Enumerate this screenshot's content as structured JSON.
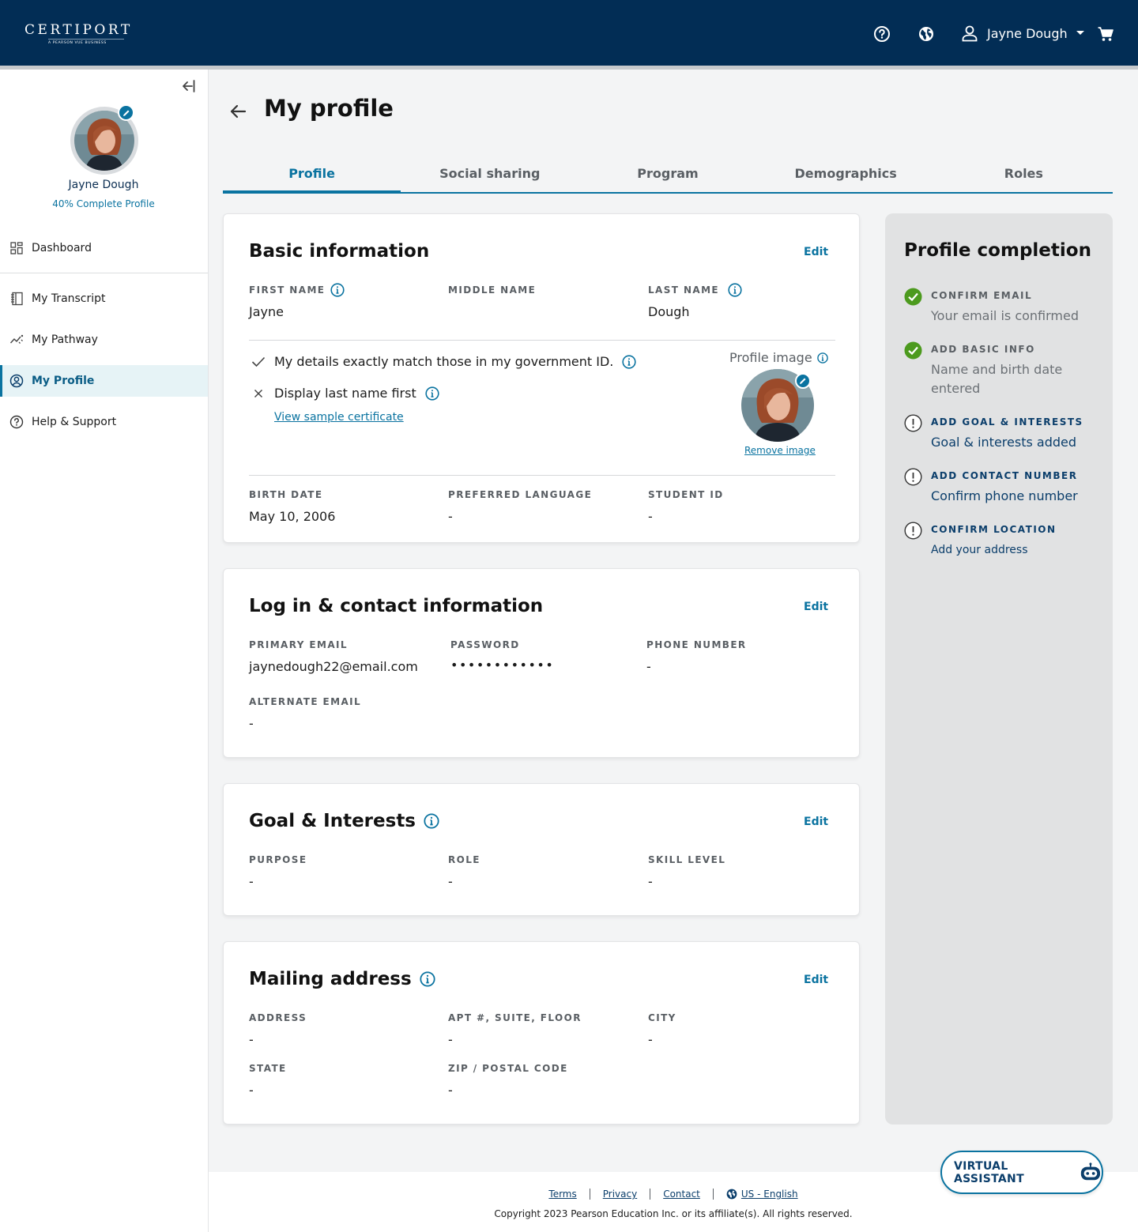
{
  "header": {
    "logo_text": "CERTIPORT",
    "logo_subtext": "A PEARSON VUE BUSINESS",
    "user_name": "Jayne Dough",
    "icons": [
      "help-icon",
      "globe-icon",
      "user-icon",
      "caret-down-icon",
      "cart-icon"
    ]
  },
  "sidebar": {
    "user_name": "Jayne Dough",
    "completion_text": "40% Complete Profile",
    "items": [
      {
        "label": "Dashboard",
        "icon": "dashboard-icon"
      },
      {
        "label": "My Transcript",
        "icon": "transcript-icon"
      },
      {
        "label": "My Pathway",
        "icon": "pathway-icon"
      },
      {
        "label": "My Profile",
        "icon": "profile-icon",
        "active": true
      },
      {
        "label": "Help & Support",
        "icon": "help-icon"
      }
    ]
  },
  "page": {
    "title": "My profile",
    "tabs": [
      {
        "label": "Profile",
        "active": true
      },
      {
        "label": "Social sharing"
      },
      {
        "label": "Program"
      },
      {
        "label": "Demographics"
      },
      {
        "label": "Roles"
      }
    ]
  },
  "basic_info": {
    "title": "Basic information",
    "edit": "Edit",
    "first_name_label": "FIRST NAME",
    "first_name": "Jayne",
    "middle_name_label": "MIDDLE NAME",
    "middle_name": "",
    "last_name_label": "LAST NAME",
    "last_name": "Dough",
    "gov_id_text": "My details exactly match those in my government ID.",
    "last_name_first_text": "Display last name first",
    "sample_link": "View sample certificate",
    "profile_image_label": "Profile image",
    "remove_image": "Remove image",
    "birth_date_label": "BIRTH DATE",
    "birth_date": "May 10, 2006",
    "preferred_language_label": "PREFERRED LANGUAGE",
    "preferred_language": "-",
    "student_id_label": "STUDENT ID",
    "student_id": "-"
  },
  "contact_info": {
    "title": "Log in & contact information",
    "edit": "Edit",
    "primary_email_label": "PRIMARY EMAIL",
    "primary_email": "jaynedough22@email.com",
    "password_label": "PASSWORD",
    "password": "••••••••••••",
    "phone_label": "PHONE NUMBER",
    "phone": "-",
    "alternate_email_label": "ALTERNATE EMAIL",
    "alternate_email": "-"
  },
  "goals": {
    "title": "Goal & Interests",
    "edit": "Edit",
    "purpose_label": "PURPOSE",
    "purpose": "-",
    "role_label": "ROLE",
    "role": "-",
    "skill_label": "SKILL LEVEL",
    "skill": "-"
  },
  "mailing": {
    "title": "Mailing address",
    "edit": "Edit",
    "address_label": "ADDRESS",
    "address": "-",
    "apt_label": "APT #, SUITE, FLOOR",
    "apt": "-",
    "city_label": "CITY",
    "city": "-",
    "state_label": "STATE",
    "state": "-",
    "zip_label": "ZIP / POSTAL CODE",
    "zip": "-"
  },
  "completion": {
    "title": "Profile completion",
    "steps": [
      {
        "title": "CONFIRM EMAIL",
        "desc": "Your email is confirmed",
        "status": "done"
      },
      {
        "title": "ADD BASIC INFO",
        "desc": "Name  and birth date entered",
        "status": "done"
      },
      {
        "title": "ADD GOAL & INTERESTS",
        "desc": "Goal & interests added",
        "status": "todo"
      },
      {
        "title": "ADD CONTACT NUMBER",
        "desc": "Confirm phone number",
        "status": "todo"
      },
      {
        "title": "CONFIRM LOCATION",
        "desc": "Add your address",
        "status": "todo"
      }
    ]
  },
  "footer": {
    "links": [
      "Terms",
      "Privacy",
      "Contact",
      "US - English"
    ],
    "copyright": "Copyright 2023 Pearson Education Inc. or its affiliate(s). All rights reserved."
  },
  "virtual_assistant": {
    "label": "VIRTUAL ASSISTANT"
  },
  "colors": {
    "header_bg": "#022d55",
    "accent": "#0a73a0",
    "success": "#4c9a1e"
  }
}
